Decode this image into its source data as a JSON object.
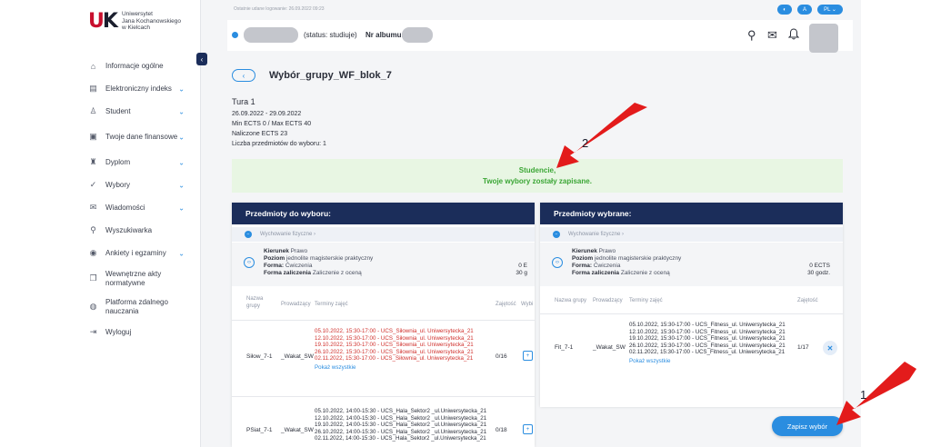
{
  "logo": {
    "mark_a": "U",
    "mark_b": "K",
    "lines": [
      "Uniwersytet",
      "Jana Kochanowskiego",
      "w Kielcach"
    ]
  },
  "sidebar": {
    "collapse_icon": "chevron-left-icon",
    "items": [
      {
        "label": "Informacje ogólne",
        "icon": "⌂",
        "chevron": ""
      },
      {
        "label": "Elektroniczny indeks",
        "icon": "▤",
        "chevron": "⌄"
      },
      {
        "label": "Student",
        "icon": "♙",
        "chevron": "⌄"
      },
      {
        "label": "Twoje dane finansowe",
        "icon": "▣",
        "chevron": "⌄"
      },
      {
        "label": "Dyplom",
        "icon": "♜",
        "chevron": "⌄"
      },
      {
        "label": "Wybory",
        "icon": "✓",
        "chevron": "⌄"
      },
      {
        "label": "Wiadomości",
        "icon": "✉",
        "chevron": "⌄"
      },
      {
        "label": "Wyszukiwarka",
        "icon": "⚲",
        "chevron": ""
      },
      {
        "label": "Ankiety i egzaminy",
        "icon": "◉",
        "chevron": "⌄"
      },
      {
        "label": "Wewnętrzne akty normatywne",
        "icon": "❐",
        "chevron": ""
      },
      {
        "label": "Platforma zdalnego nauczania",
        "icon": "◍",
        "chevron": ""
      },
      {
        "label": "Wyloguj",
        "icon": "⇥",
        "chevron": ""
      }
    ]
  },
  "topbar": {
    "last_login": "Ostatnie udane logowanie: 26.09.2022 09:23",
    "pills": [
      "◐",
      "A",
      "PL ⌄"
    ],
    "status": "(status: studiuje)",
    "album_label": "Nr albumu:",
    "icons": {
      "search": "⚲",
      "mail": "✉",
      "bell": "♫"
    }
  },
  "page": {
    "back": "‹",
    "title": "Wybór_grupy_WF_blok_7",
    "tura": "Tura 1",
    "info": [
      "26.09.2022 - 29.09.2022",
      "Min ECTS 0 / Max ECTS 40",
      "Naliczone ECTS 23",
      "Liczba przedmiotów do wyboru: 1"
    ],
    "success": [
      "Studencie,",
      "Twoje wybory zostały zapisane."
    ],
    "save_button": "Zapisz wybór"
  },
  "course": {
    "subgroup": "Wychowanie fizyczne ›",
    "kierunek_label": "Kierunek",
    "kierunek": "Prawo",
    "poziom_label": "Poziom",
    "poziom": "jednolite magisterskie praktyczny",
    "forma_label": "Forma:",
    "forma": "Ćwiczenia",
    "zaliczenie_label": "Forma zaliczenia",
    "zaliczenie": "Zaliczenie z oceną",
    "ects": "0 ECTS",
    "godz": "30 godz.",
    "ects_short": "0  E",
    "godz_short": "30  g"
  },
  "left_panel": {
    "title": "Przedmioty do wyboru:",
    "headers": {
      "name": "Nazwa grupy",
      "lecturer": "Prowadzący",
      "terms": "Terminy zajęć",
      "occupancy": "Zajętość",
      "choose": "Wybi"
    },
    "rows": [
      {
        "name": "Siłow_7-1",
        "lecturer": "_Wakat_SW",
        "occupancy": "0/16",
        "terms": [
          "05.10.2022, 15:30-17:00 - UCS_Siłownia_ul. Uniwersytecka_21",
          "12.10.2022, 15:30-17:00 - UCS_Siłownia_ul. Uniwersytecka_21",
          "19.10.2022, 15:30-17:00 - UCS_Siłownia_ul. Uniwersytecka_21",
          "26.10.2022, 15:30-17:00 - UCS_Siłownia_ul. Uniwersytecka_21",
          "02.11.2022, 15:30-17:00 - UCS_Siłownia_ul. Uniwersytecka_21"
        ],
        "show_all": "Pokaż wszystkie"
      },
      {
        "name": "PSiat_7-1",
        "lecturer": "_Wakat_SW",
        "occupancy": "0/18",
        "terms": [
          "05.10.2022, 14:00-15:30 - UCS_Hala_Sektor2 _ul.Uniwersytecka_21",
          "12.10.2022, 14:00-15:30 - UCS_Hala_Sektor2 _ul.Uniwersytecka_21",
          "19.10.2022, 14:00-15:30 - UCS_Hala_Sektor2 _ul.Uniwersytecka_21",
          "26.10.2022, 14:00-15:30 - UCS_Hala_Sektor2 _ul.Uniwersytecka_21",
          "02.11.2022, 14:00-15:30 - UCS_Hala_Sektor2 _ul.Uniwersytecka_21"
        ]
      }
    ]
  },
  "right_panel": {
    "title": "Przedmioty wybrane:",
    "headers": {
      "name": "Nazwa grupy",
      "lecturer": "Prowadzący",
      "terms": "Terminy zajęć",
      "occupancy": "Zajętość"
    },
    "rows": [
      {
        "name": "Fit_7-1",
        "lecturer": "_Wakat_SW",
        "occupancy": "1/17",
        "terms": [
          "05.10.2022, 15:30-17:00 - UCS_Fitness_ul. Uniwersytecka_21",
          "12.10.2022, 15:30-17:00 - UCS_Fitness_ul. Uniwersytecka_21",
          "19.10.2022, 15:30-17:00 - UCS_Fitness_ul. Uniwersytecka_21",
          "26.10.2022, 15:30-17:00 - UCS_Fitness_ul. Uniwersytecka_21",
          "02.11.2022, 15:30-17:00 - UCS_Fitness_ul. Uniwersytecka_21"
        ],
        "show_all": "Pokaż wszystkie",
        "remove": "✕"
      }
    ]
  },
  "annotations": {
    "label_1": "1",
    "label_2": "2",
    "arrow_color": "#e31b1b"
  },
  "colors": {
    "accent": "#2a8de0",
    "navy": "#1b2d5a",
    "success_bg": "#e8f6e3",
    "success_text": "#3ba635",
    "red_text": "#d0312d"
  }
}
